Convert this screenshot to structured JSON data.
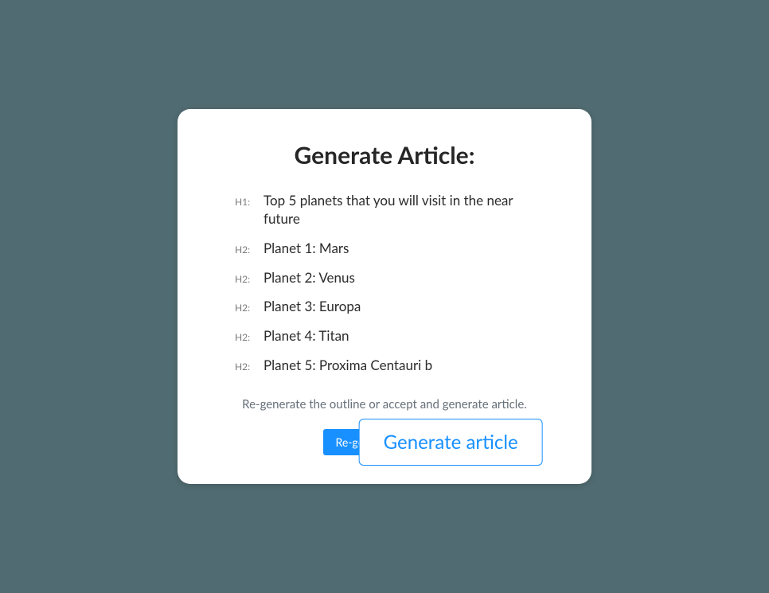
{
  "card": {
    "title": "Generate Article:",
    "helper_text": "Re-generate the outline or accept and generate article.",
    "outline": [
      {
        "level": "H1:",
        "text": "Top 5 planets that you will visit in the near future"
      },
      {
        "level": "H2:",
        "text": "Planet 1: Mars"
      },
      {
        "level": "H2:",
        "text": "Planet 2: Venus"
      },
      {
        "level": "H2:",
        "text": "Planet 3: Europa"
      },
      {
        "level": "H2:",
        "text": "Planet 4: Titan"
      },
      {
        "level": "H2:",
        "text": "Planet 5: Proxima Centauri b"
      }
    ],
    "buttons": {
      "regenerate": "Re-generate headlin",
      "generate": "Generate article"
    }
  }
}
